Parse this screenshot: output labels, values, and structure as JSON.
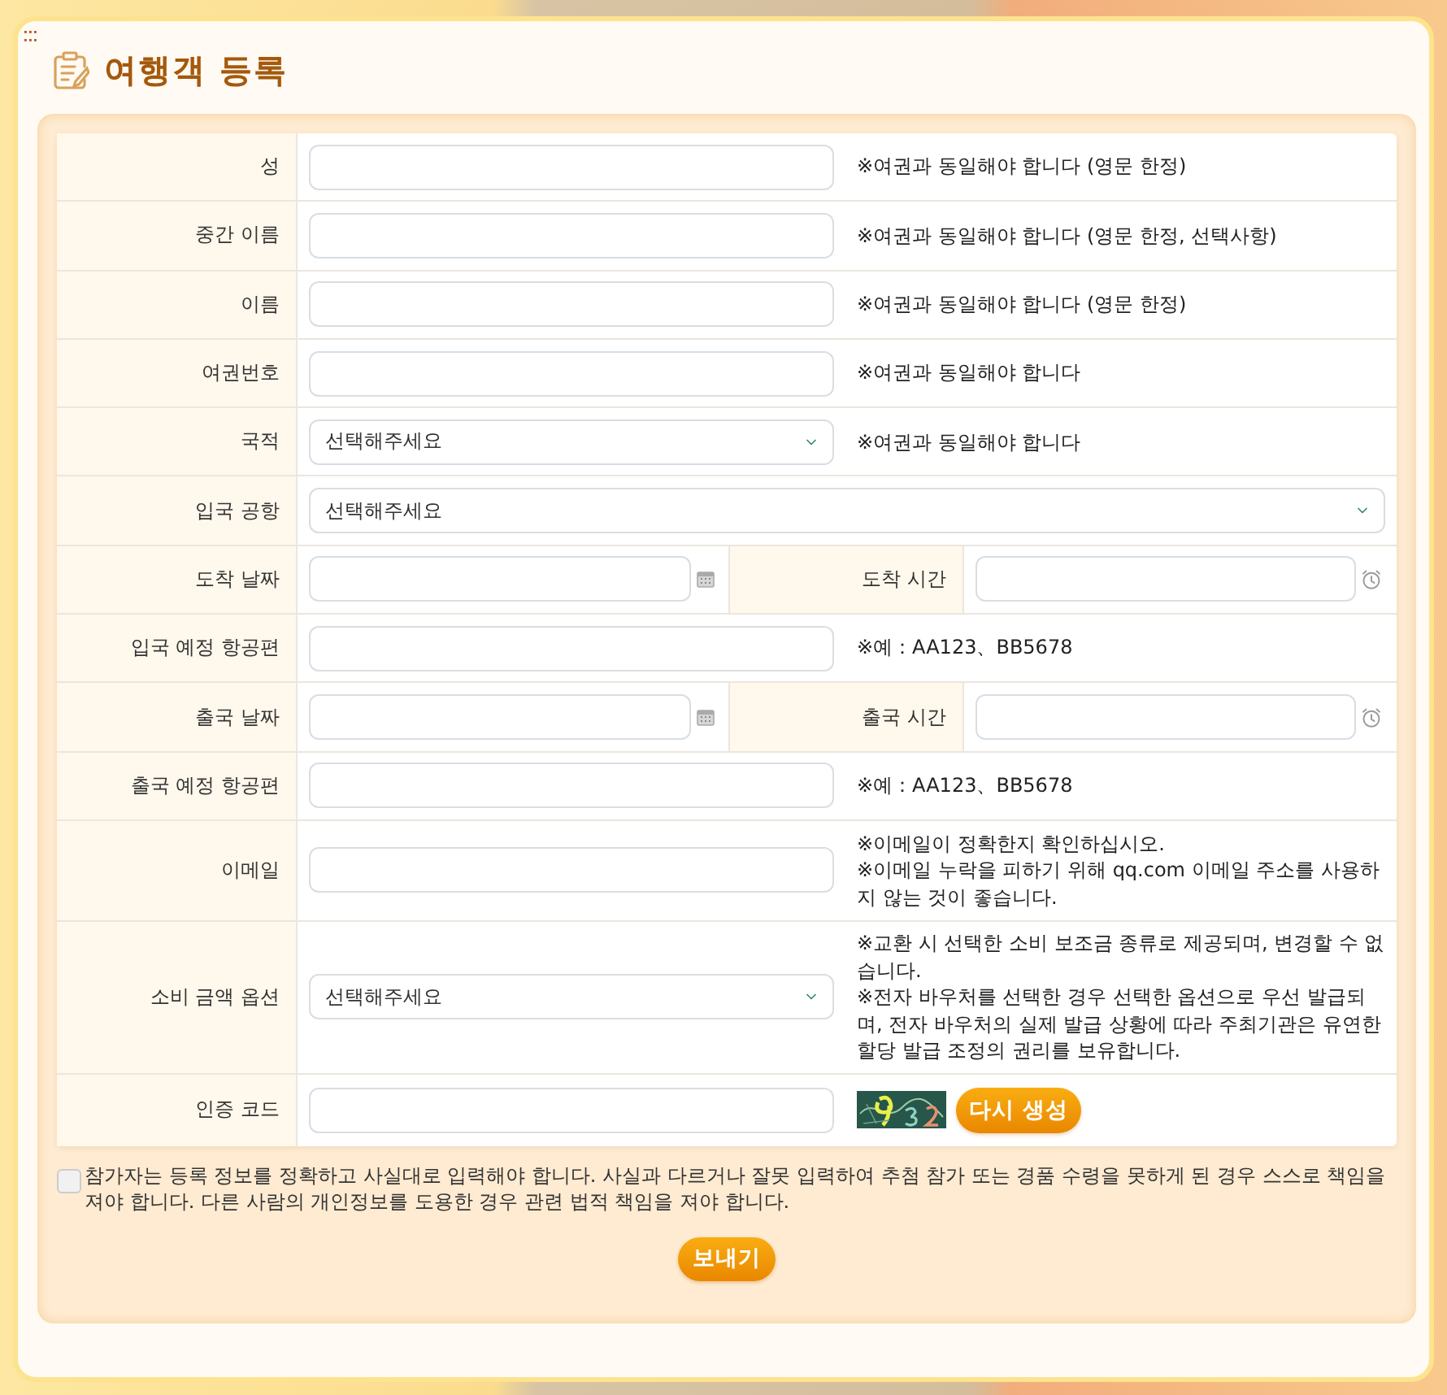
{
  "window": {
    "title": "여행객 등록"
  },
  "form": {
    "rows": [
      {
        "kind": "text",
        "label": "성",
        "notes": [
          "※여권과 동일해야 합니다 (영문 한정)"
        ]
      },
      {
        "kind": "text",
        "label": "중간 이름",
        "notes": [
          "※여권과 동일해야 합니다 (영문 한정, 선택사항)"
        ]
      },
      {
        "kind": "text",
        "label": "이름",
        "notes": [
          "※여권과 동일해야 합니다 (영문 한정)"
        ]
      },
      {
        "kind": "text",
        "label": "여권번호",
        "notes": [
          "※여권과 동일해야 합니다"
        ]
      },
      {
        "kind": "select",
        "label": "국적",
        "placeholder": "선택해주세요",
        "notes": [
          "※여권과 동일해야 합니다"
        ]
      },
      {
        "kind": "wide_select",
        "label": "입국 공항",
        "placeholder": "선택해주세요"
      },
      {
        "kind": "pair",
        "fields": [
          {
            "kind": "date",
            "label": "도착 날짜"
          },
          {
            "kind": "time",
            "label": "도착 시간"
          }
        ]
      },
      {
        "kind": "text",
        "label": "입국 예정 항공편",
        "notes": [
          "※예：AA123、BB5678"
        ]
      },
      {
        "kind": "pair",
        "fields": [
          {
            "kind": "date",
            "label": "출국 날짜"
          },
          {
            "kind": "time",
            "label": "출국 시간"
          }
        ]
      },
      {
        "kind": "text",
        "label": "출국 예정 항공편",
        "notes": [
          "※예：AA123、BB5678"
        ]
      },
      {
        "kind": "text",
        "label": "이메일",
        "notes": [
          "※이메일이 정확한지 확인하십시오.",
          "※이메일 누락을 피하기 위해 qq.com 이메일 주소를 사용하지 않는 것이 좋습니다."
        ]
      },
      {
        "kind": "select",
        "label": "소비 금액 옵션",
        "placeholder": "선택해주세요",
        "notes": [
          "※교환 시 선택한 소비 보조금 종류로 제공되며, 변경할 수 없습니다.",
          "※전자 바우처를 선택한 경우 선택한 옵션으로 우선 발급되며, 전자 바우처의 실제 발급 상황에 따라 주최기관은 유연한 할당 발급 조정의 권리를 보유합니다."
        ]
      },
      {
        "kind": "captcha",
        "label": "인증 코드",
        "button": "다시 생성"
      }
    ]
  },
  "agreement": {
    "checked": false,
    "text": "참가자는 등록 정보를 정확하고 사실대로 입력해야 합니다. 사실과 다르거나 잘못 입력하여 추첨 참가 또는 경품 수령을 못하게 된 경우 스스로 책임을 져야 합니다. 다른 사람의 개인정보를 도용한 경우 관련 법적 책임을 져야 합니다."
  },
  "submit": {
    "label": "보내기"
  }
}
